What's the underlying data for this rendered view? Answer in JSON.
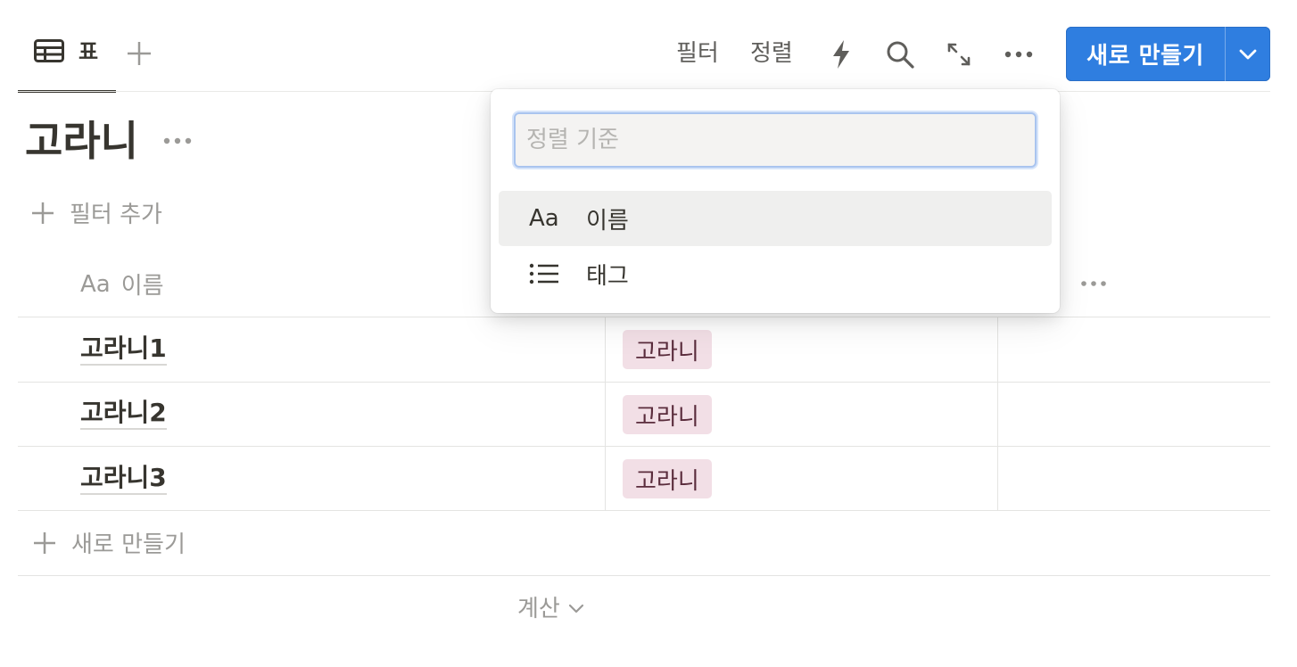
{
  "toolbar": {
    "view_tab_label": "표",
    "filter_label": "필터",
    "sort_label": "정렬",
    "new_button_label": "새로 만들기"
  },
  "database": {
    "title": "고라니",
    "add_filter_label": "필터 추가"
  },
  "table": {
    "columns": [
      {
        "icon": "Aa",
        "label": "이름"
      }
    ],
    "rows": [
      {
        "name": "고라니1",
        "tag": "고라니"
      },
      {
        "name": "고라니2",
        "tag": "고라니"
      },
      {
        "name": "고라니3",
        "tag": "고라니"
      }
    ],
    "new_row_label": "새로 만들기",
    "calculate_label": "계산"
  },
  "sort_popup": {
    "placeholder": "정렬 기준",
    "options": [
      {
        "icon": "Aa",
        "label": "이름"
      },
      {
        "icon": "list-icon",
        "label": "태그"
      }
    ]
  },
  "colors": {
    "accent": "#2f7ee0",
    "tag_bg": "#f2dfe6",
    "text": "#37352f",
    "muted": "#9b9a97"
  }
}
